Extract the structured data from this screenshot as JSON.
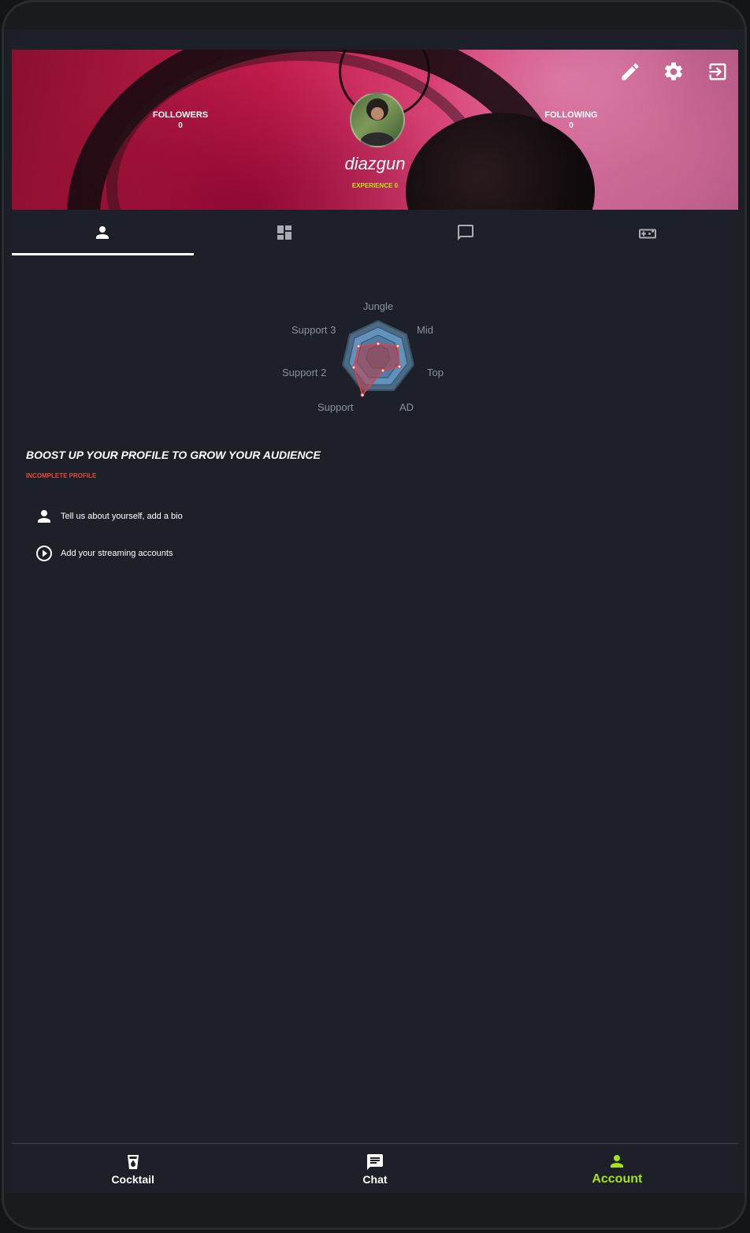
{
  "header": {
    "followers_label": "FOLLOWERS",
    "followers_count": "0",
    "following_label": "FOLLOWING",
    "following_count": "0",
    "username": "diazgun",
    "experience": "EXPERIENCE 0",
    "icons": [
      "pencil-icon",
      "gear-icon",
      "logout-icon"
    ]
  },
  "tabs": [
    {
      "icon": "person-icon",
      "active": true
    },
    {
      "icon": "dashboard-icon",
      "active": false
    },
    {
      "icon": "chat-bubble-icon",
      "active": false
    },
    {
      "icon": "gamepad-icon",
      "active": false
    }
  ],
  "radar": {
    "axes": [
      "Jungle",
      "Mid",
      "Top",
      "AD",
      "Support",
      "Support 2",
      "Support 3"
    ]
  },
  "boost": {
    "title": "BOOST UP YOUR PROFILE TO GROW YOUR AUDIENCE",
    "subtitle": "INCOMPLETE PROFILE",
    "tasks": [
      {
        "icon": "person-icon",
        "label": "Tell us about yourself, add a bio"
      },
      {
        "icon": "play-circle-icon",
        "label": "Add your streaming accounts"
      }
    ]
  },
  "bottom_nav": [
    {
      "label": "Cocktail",
      "icon": "cocktail-icon",
      "active": false
    },
    {
      "label": "Chat",
      "icon": "chat-icon",
      "active": false
    },
    {
      "label": "Account",
      "icon": "account-icon",
      "active": true
    }
  ],
  "colors": {
    "accent": "#a6e31a",
    "warning": "#e24b3b",
    "background": "#1d2028"
  }
}
